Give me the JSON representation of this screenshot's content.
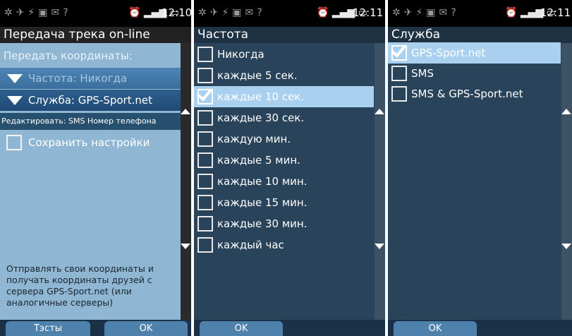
{
  "statusbar": {
    "screen1_time": "12:10",
    "screen2_time": "12:11",
    "screen3_time": "12:11"
  },
  "screen1": {
    "title": "Передача трека on-line",
    "coords_label": "Передать координаты:",
    "frequency_label": "Частота: Никогда",
    "service_label": "Служба: GPS-Sport.net",
    "edit_label": "Редактировать: SMS Номер телефона",
    "save_settings_label": "Сохранить настройки",
    "description": "Отправлять свои координаты и получать координаты друзей с сервера GPS-Sport.net (или аналогичные серверы)",
    "tests_button": "Тэсты",
    "ok_button": "OK"
  },
  "screen2": {
    "title": "Частота",
    "items": [
      {
        "label": "Никогда",
        "checked": false
      },
      {
        "label": "каждые 5 сек.",
        "checked": false
      },
      {
        "label": "каждые 10 сек.",
        "checked": true
      },
      {
        "label": "каждые 30 сек.",
        "checked": false
      },
      {
        "label": "каждую мин.",
        "checked": false
      },
      {
        "label": "каждые 5 мин.",
        "checked": false
      },
      {
        "label": "каждые 10 мин.",
        "checked": false
      },
      {
        "label": "каждые 15 мин.",
        "checked": false
      },
      {
        "label": "каждые 30 мин.",
        "checked": false
      },
      {
        "label": "каждый час",
        "checked": false
      }
    ],
    "ok_button": "OK"
  },
  "screen3": {
    "title": "Служба",
    "items": [
      {
        "label": "GPS-Sport.net",
        "checked": true
      },
      {
        "label": "SMS",
        "checked": false
      },
      {
        "label": "SMS & GPS-Sport.net",
        "checked": false
      }
    ],
    "ok_button": "OK"
  }
}
